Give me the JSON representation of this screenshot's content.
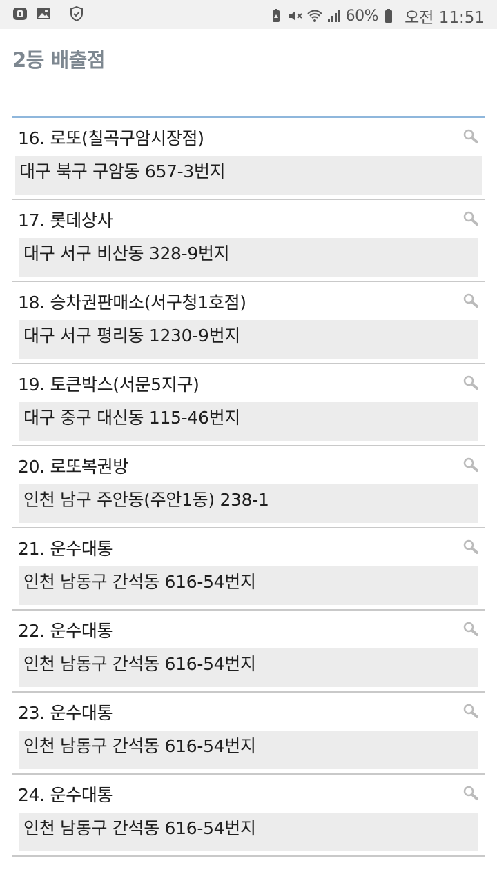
{
  "status_bar": {
    "battery": "60%",
    "time": "오전 11:51"
  },
  "page": {
    "title": "2등 배출점"
  },
  "stores": [
    {
      "name": "16. 로또(칠곡구암시장점)",
      "address": "대구 북구 구암동 657-3번지"
    },
    {
      "name": "17. 롯데상사",
      "address": "대구 서구 비산동 328-9번지"
    },
    {
      "name": "18. 승차권판매소(서구청1호점)",
      "address": "대구 서구 평리동 1230-9번지"
    },
    {
      "name": "19. 토큰박스(서문5지구)",
      "address": "대구 중구 대신동 115-46번지"
    },
    {
      "name": "20. 로또복권방",
      "address": "인천 남구 주안동(주안1동) 238-1"
    },
    {
      "name": "21. 운수대통",
      "address": "인천 남동구 간석동 616-54번지"
    },
    {
      "name": "22. 운수대통",
      "address": "인천 남동구 간석동 616-54번지"
    },
    {
      "name": "23. 운수대통",
      "address": "인천 남동구 간석동 616-54번지"
    },
    {
      "name": "24. 운수대통",
      "address": "인천 남동구 간석동 616-54번지"
    }
  ],
  "icons": {
    "status_left": [
      "app-notification-icon",
      "gallery-icon",
      "shield-check-icon"
    ],
    "status_right": [
      "battery-saver-icon",
      "mute-icon",
      "wifi-icon",
      "signal-icon",
      "battery-icon"
    ],
    "row_action": "search-icon"
  },
  "colors": {
    "title": "#7d8790",
    "list_top_border": "#8fb7dc",
    "address_background": "#ececec",
    "divider": "#c9c9c9"
  }
}
